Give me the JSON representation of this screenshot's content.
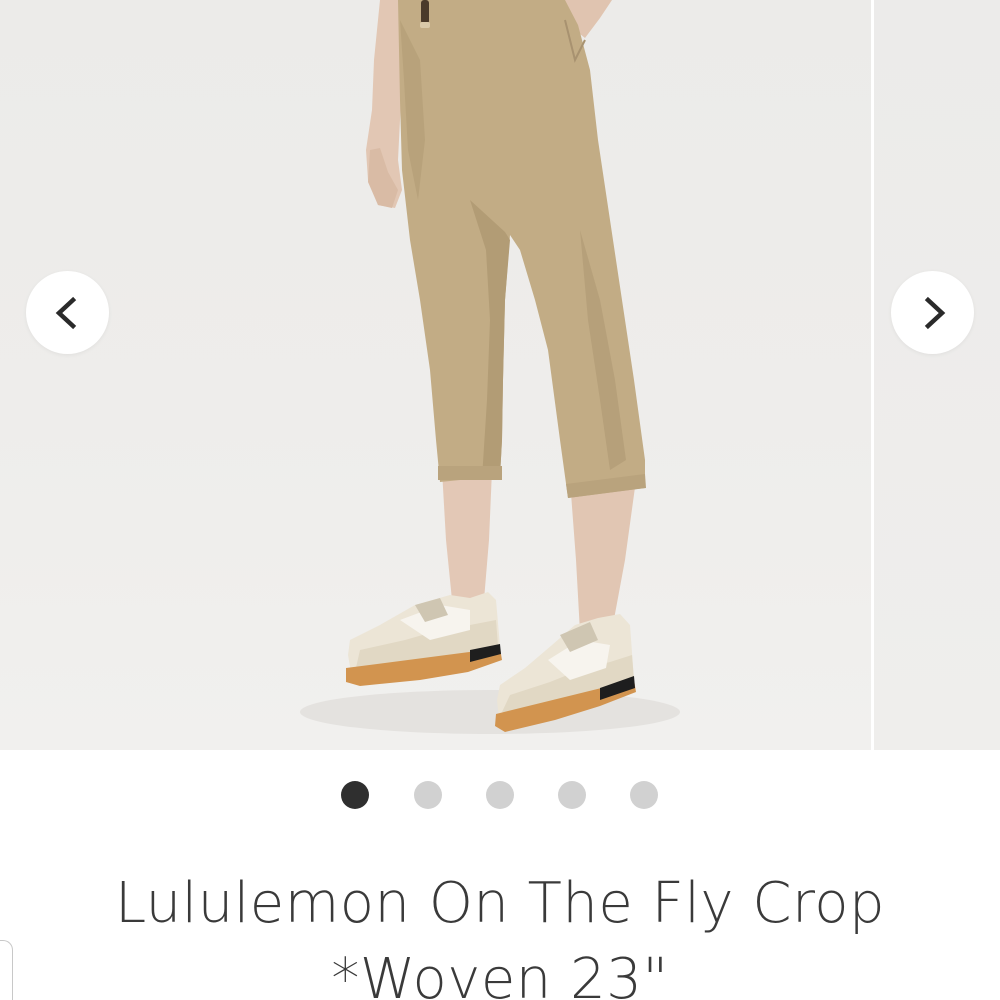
{
  "product": {
    "title_line1": "Lululemon On The Fly Crop",
    "title_line2": "*Woven 23\""
  },
  "carousel": {
    "image_count": 5,
    "active_index": 0,
    "prev_icon": "chevron-left-icon",
    "next_icon": "chevron-right-icon"
  },
  "colors": {
    "dot_active": "#2f2f2f",
    "dot_inactive": "#d1d1d1",
    "pants": "#c2ac85",
    "background": "#eeedeb"
  }
}
